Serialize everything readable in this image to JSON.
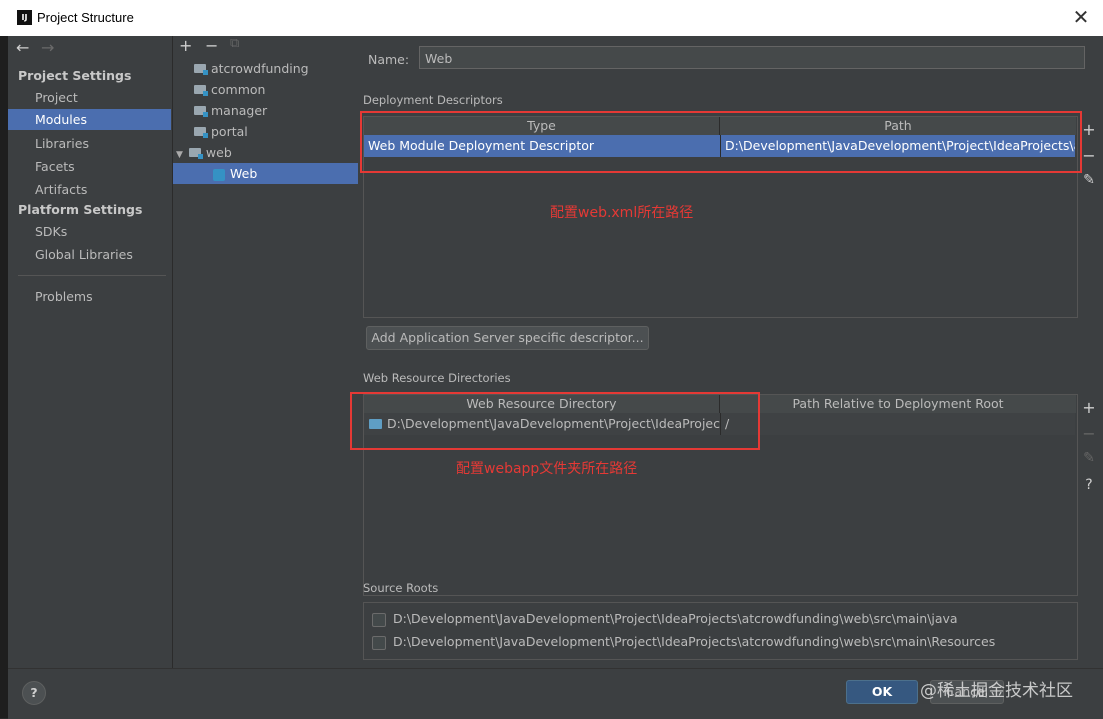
{
  "window": {
    "title": "Project Structure",
    "logo_text": "IJ",
    "close_glyph": "✕"
  },
  "nav": {
    "back": "←",
    "forward": "→"
  },
  "sidebar": {
    "section_project": "Project Settings",
    "project_items": [
      "Project",
      "Modules",
      "Libraries",
      "Facets",
      "Artifacts"
    ],
    "section_platform": "Platform Settings",
    "platform_items": [
      "SDKs",
      "Global Libraries"
    ],
    "problems": "Problems",
    "selected": "Modules"
  },
  "tree": {
    "toolbar": {
      "add": "+",
      "remove": "−",
      "copy": "⧉"
    },
    "nodes": [
      "atcrowdfunding",
      "common",
      "manager",
      "portal",
      "web"
    ],
    "expander": "▼",
    "child": "Web"
  },
  "main": {
    "name_label": "Name:",
    "name_value": "Web",
    "deploy_group": "Deployment Descriptors",
    "deploy_headers": [
      "Type",
      "Path"
    ],
    "deploy_row": {
      "type": "Web Module Deployment Descriptor",
      "path": "D:\\Development\\JavaDevelopment\\Project\\IdeaProjects\\atcr"
    },
    "add_server_button": "Add Application Server specific descriptor...",
    "resource_group": "Web Resource Directories",
    "resource_headers": [
      "Web Resource Directory",
      "Path Relative to Deployment Root"
    ],
    "resource_row": {
      "dir": "D:\\Development\\JavaDevelopment\\Project\\IdeaProject...",
      "rel": "/"
    },
    "source_group": "Source Roots",
    "source_roots": [
      "D:\\Development\\JavaDevelopment\\Project\\IdeaProjects\\atcrowdfunding\\web\\src\\main\\java",
      "D:\\Development\\JavaDevelopment\\Project\\IdeaProjects\\atcrowdfunding\\web\\src\\main\\Resources"
    ],
    "side_buttons": {
      "add": "+",
      "remove": "−",
      "edit": "✎",
      "help": "?"
    }
  },
  "annotations": {
    "web_xml": "配置web.xml所在路径",
    "webapp": "配置webapp文件夹所在路径",
    "color": "#e53935"
  },
  "footer": {
    "help": "?",
    "ok": "OK",
    "cancel": "Cancel",
    "watermark": "@稀土掘金技术社区"
  },
  "colors": {
    "selection": "#4b6eaf",
    "panel": "#3c3f41",
    "ok_button": "#365880"
  }
}
